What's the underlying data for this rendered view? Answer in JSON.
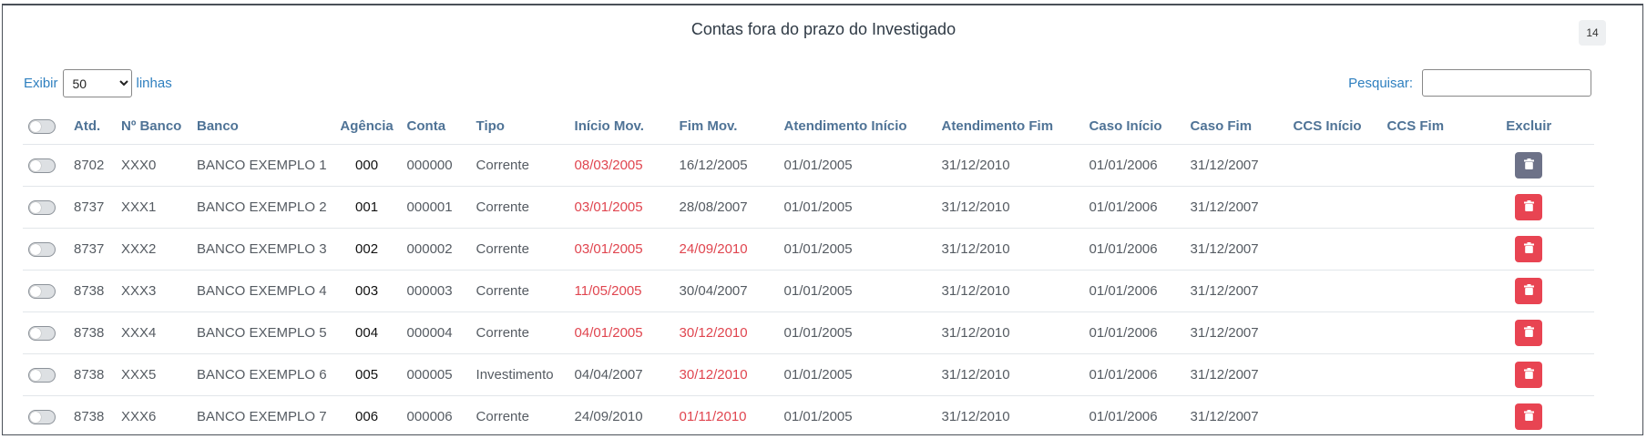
{
  "header": {
    "title": "Contas fora do prazo do Investigado",
    "count_badge": "14"
  },
  "length_control": {
    "prefix": "Exibir",
    "selected": "50",
    "options": [
      "50"
    ],
    "suffix": "linhas"
  },
  "search": {
    "label": "Pesquisar:",
    "value": ""
  },
  "table": {
    "columns": [
      "",
      "Atd.",
      "Nº Banco",
      "Banco",
      "Agência",
      "Conta",
      "Tipo",
      "Início Mov.",
      "Fim Mov.",
      "Atendimento Início",
      "Atendimento Fim",
      "Caso Início",
      "Caso Fim",
      "CCS Início",
      "CCS Fim",
      "Excluir"
    ],
    "rows": [
      {
        "atd": "8702",
        "nbanco": "XXX0",
        "banco": "BANCO EXEMPLO 1",
        "agencia": "000",
        "conta": "000000",
        "tipo": "Corrente",
        "inicio_mov": "08/03/2005",
        "fim_mov": "16/12/2005",
        "at_inicio": "01/01/2005",
        "at_fim": "31/12/2010",
        "caso_inicio": "01/01/2006",
        "caso_fim": "31/12/2007",
        "ccs_inicio": "",
        "ccs_fim": "",
        "inicio_alert": true,
        "fim_alert": false,
        "delete_variant": "gray"
      },
      {
        "atd": "8737",
        "nbanco": "XXX1",
        "banco": "BANCO EXEMPLO 2",
        "agencia": "001",
        "conta": "000001",
        "tipo": "Corrente",
        "inicio_mov": "03/01/2005",
        "fim_mov": "28/08/2007",
        "at_inicio": "01/01/2005",
        "at_fim": "31/12/2010",
        "caso_inicio": "01/01/2006",
        "caso_fim": "31/12/2007",
        "ccs_inicio": "",
        "ccs_fim": "",
        "inicio_alert": true,
        "fim_alert": false,
        "delete_variant": "red"
      },
      {
        "atd": "8737",
        "nbanco": "XXX2",
        "banco": "BANCO EXEMPLO 3",
        "agencia": "002",
        "conta": "000002",
        "tipo": "Corrente",
        "inicio_mov": "03/01/2005",
        "fim_mov": "24/09/2010",
        "at_inicio": "01/01/2005",
        "at_fim": "31/12/2010",
        "caso_inicio": "01/01/2006",
        "caso_fim": "31/12/2007",
        "ccs_inicio": "",
        "ccs_fim": "",
        "inicio_alert": true,
        "fim_alert": true,
        "delete_variant": "red"
      },
      {
        "atd": "8738",
        "nbanco": "XXX3",
        "banco": "BANCO EXEMPLO 4",
        "agencia": "003",
        "conta": "000003",
        "tipo": "Corrente",
        "inicio_mov": "11/05/2005",
        "fim_mov": "30/04/2007",
        "at_inicio": "01/01/2005",
        "at_fim": "31/12/2010",
        "caso_inicio": "01/01/2006",
        "caso_fim": "31/12/2007",
        "ccs_inicio": "",
        "ccs_fim": "",
        "inicio_alert": true,
        "fim_alert": false,
        "delete_variant": "red"
      },
      {
        "atd": "8738",
        "nbanco": "XXX4",
        "banco": "BANCO EXEMPLO 5",
        "agencia": "004",
        "conta": "000004",
        "tipo": "Corrente",
        "inicio_mov": "04/01/2005",
        "fim_mov": "30/12/2010",
        "at_inicio": "01/01/2005",
        "at_fim": "31/12/2010",
        "caso_inicio": "01/01/2006",
        "caso_fim": "31/12/2007",
        "ccs_inicio": "",
        "ccs_fim": "",
        "inicio_alert": true,
        "fim_alert": true,
        "delete_variant": "red"
      },
      {
        "atd": "8738",
        "nbanco": "XXX5",
        "banco": "BANCO EXEMPLO 6",
        "agencia": "005",
        "conta": "000005",
        "tipo": "Investimento",
        "inicio_mov": "04/04/2007",
        "fim_mov": "30/12/2010",
        "at_inicio": "01/01/2005",
        "at_fim": "31/12/2010",
        "caso_inicio": "01/01/2006",
        "caso_fim": "31/12/2007",
        "ccs_inicio": "",
        "ccs_fim": "",
        "inicio_alert": false,
        "fim_alert": true,
        "delete_variant": "red"
      },
      {
        "atd": "8738",
        "nbanco": "XXX6",
        "banco": "BANCO EXEMPLO 7",
        "agencia": "006",
        "conta": "000006",
        "tipo": "Corrente",
        "inicio_mov": "24/09/2010",
        "fim_mov": "01/11/2010",
        "at_inicio": "01/01/2005",
        "at_fim": "31/12/2010",
        "caso_inicio": "01/01/2006",
        "caso_fim": "31/12/2007",
        "ccs_inicio": "",
        "ccs_fim": "",
        "inicio_alert": false,
        "fim_alert": true,
        "delete_variant": "red"
      }
    ]
  },
  "icons": {
    "row_toggle": "toggle-switch-icon",
    "delete": "trash-icon"
  },
  "colors": {
    "alert_text": "#e0454f",
    "delete_red": "#e84452",
    "delete_gray": "#6d7288",
    "link_blue": "#2e7fbf",
    "header_blue": "#4f7396"
  }
}
